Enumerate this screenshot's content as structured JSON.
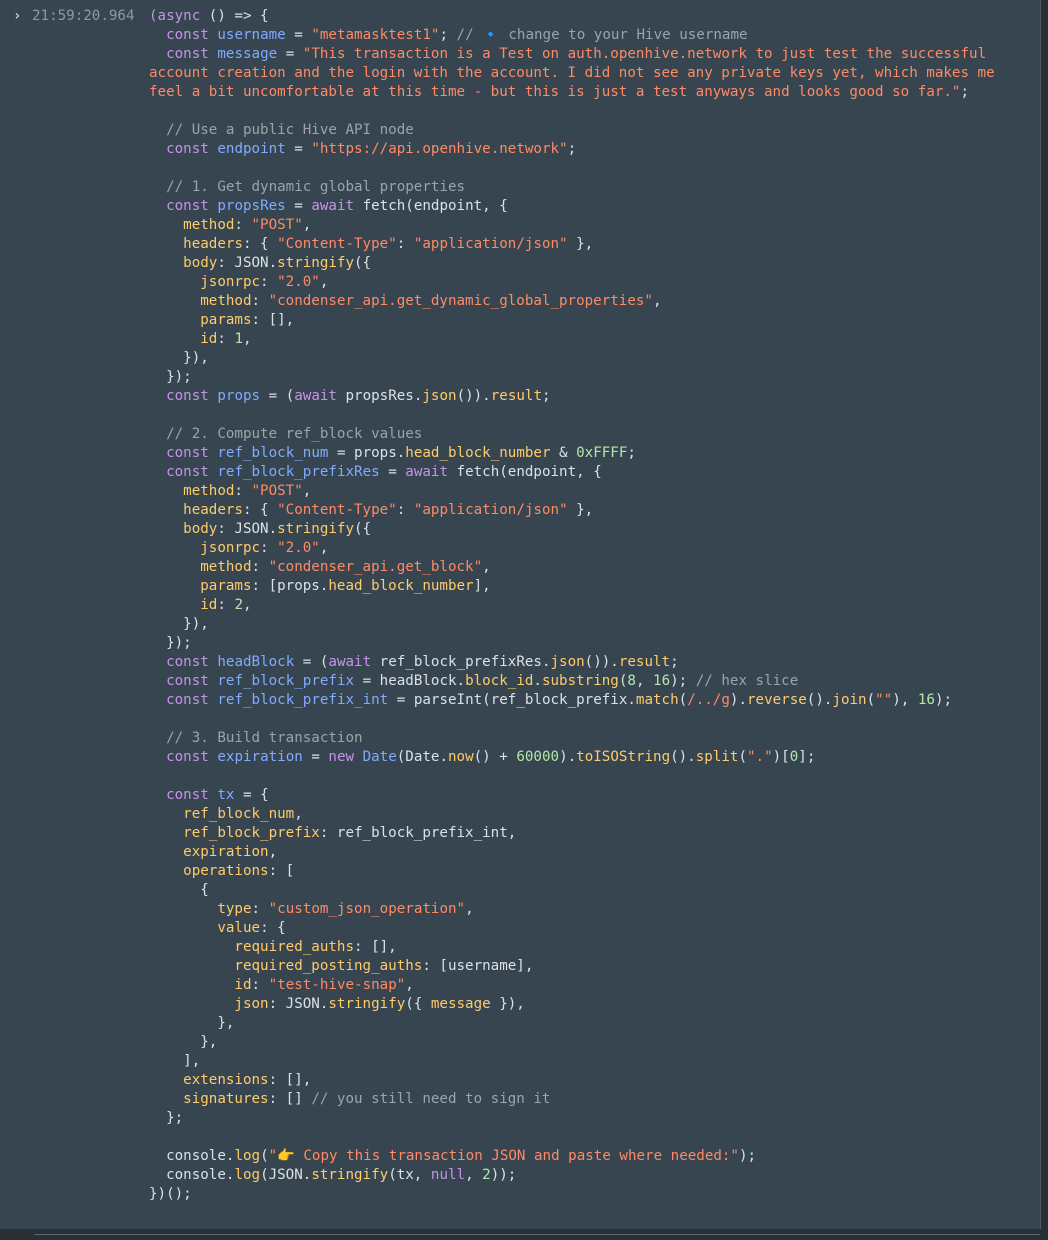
{
  "console": {
    "prompt_symbol": "›",
    "timestamp": "21:59:20.964",
    "accent_string": "#ff8a65",
    "accent_keyword": "#c792ea",
    "accent_variable": "#82aaff",
    "accent_property": "#ffcb6b",
    "accent_number": "#b5e8a8",
    "accent_comment": "#9aa4ab",
    "code_lines": [
      [
        {
          "t": "kw",
          "s": "(async"
        },
        {
          "t": "pl",
          "s": " () => {"
        }
      ],
      [
        {
          "t": "pl",
          "s": "  "
        },
        {
          "t": "kw",
          "s": "const"
        },
        {
          "t": "pl",
          "s": " "
        },
        {
          "t": "vr",
          "s": "username"
        },
        {
          "t": "pl",
          "s": " = "
        },
        {
          "t": "st",
          "s": "\"metamasktest1\""
        },
        {
          "t": "pl",
          "s": "; "
        },
        {
          "t": "cm",
          "s": "// "
        },
        {
          "t": "ic",
          "s": "🔹"
        },
        {
          "t": "cm",
          "s": " change to your Hive username"
        }
      ],
      [
        {
          "t": "pl",
          "s": "  "
        },
        {
          "t": "kw",
          "s": "const"
        },
        {
          "t": "pl",
          "s": " "
        },
        {
          "t": "vr",
          "s": "message"
        },
        {
          "t": "pl",
          "s": " = "
        },
        {
          "t": "st",
          "s": "\"This transaction is a Test on auth.openhive.network to just test the successful account creation and the login with the account. I did not see any private keys yet, which makes me feel a bit uncomfortable at this time - but this is just a test anyways and looks good so far.\""
        },
        {
          "t": "pl",
          "s": ";"
        }
      ],
      [],
      [
        {
          "t": "pl",
          "s": "  "
        },
        {
          "t": "cm",
          "s": "// Use a public Hive API node"
        }
      ],
      [
        {
          "t": "pl",
          "s": "  "
        },
        {
          "t": "kw",
          "s": "const"
        },
        {
          "t": "pl",
          "s": " "
        },
        {
          "t": "vr",
          "s": "endpoint"
        },
        {
          "t": "pl",
          "s": " = "
        },
        {
          "t": "st",
          "s": "\"https://api.openhive.network\""
        },
        {
          "t": "pl",
          "s": ";"
        }
      ],
      [],
      [
        {
          "t": "pl",
          "s": "  "
        },
        {
          "t": "cm",
          "s": "// 1. Get dynamic global properties"
        }
      ],
      [
        {
          "t": "pl",
          "s": "  "
        },
        {
          "t": "kw",
          "s": "const"
        },
        {
          "t": "pl",
          "s": " "
        },
        {
          "t": "vr",
          "s": "propsRes"
        },
        {
          "t": "pl",
          "s": " = "
        },
        {
          "t": "kw",
          "s": "await"
        },
        {
          "t": "pl",
          "s": " fetch(endpoint, {"
        }
      ],
      [
        {
          "t": "pl",
          "s": "    "
        },
        {
          "t": "pr",
          "s": "method"
        },
        {
          "t": "pl",
          "s": ": "
        },
        {
          "t": "st",
          "s": "\"POST\""
        },
        {
          "t": "pl",
          "s": ","
        }
      ],
      [
        {
          "t": "pl",
          "s": "    "
        },
        {
          "t": "pr",
          "s": "headers"
        },
        {
          "t": "pl",
          "s": ": { "
        },
        {
          "t": "st",
          "s": "\"Content-Type\""
        },
        {
          "t": "pl",
          "s": ": "
        },
        {
          "t": "st",
          "s": "\"application/json\""
        },
        {
          "t": "pl",
          "s": " },"
        }
      ],
      [
        {
          "t": "pl",
          "s": "    "
        },
        {
          "t": "pr",
          "s": "body"
        },
        {
          "t": "pl",
          "s": ": JSON."
        },
        {
          "t": "pr",
          "s": "stringify"
        },
        {
          "t": "pl",
          "s": "({"
        }
      ],
      [
        {
          "t": "pl",
          "s": "      "
        },
        {
          "t": "pr",
          "s": "jsonrpc"
        },
        {
          "t": "pl",
          "s": ": "
        },
        {
          "t": "st",
          "s": "\"2.0\""
        },
        {
          "t": "pl",
          "s": ","
        }
      ],
      [
        {
          "t": "pl",
          "s": "      "
        },
        {
          "t": "pr",
          "s": "method"
        },
        {
          "t": "pl",
          "s": ": "
        },
        {
          "t": "st",
          "s": "\"condenser_api.get_dynamic_global_properties\""
        },
        {
          "t": "pl",
          "s": ","
        }
      ],
      [
        {
          "t": "pl",
          "s": "      "
        },
        {
          "t": "pr",
          "s": "params"
        },
        {
          "t": "pl",
          "s": ": [],"
        }
      ],
      [
        {
          "t": "pl",
          "s": "      "
        },
        {
          "t": "pr",
          "s": "id"
        },
        {
          "t": "pl",
          "s": ": "
        },
        {
          "t": "nu",
          "s": "1"
        },
        {
          "t": "pl",
          "s": ","
        }
      ],
      [
        {
          "t": "pl",
          "s": "    }),"
        }
      ],
      [
        {
          "t": "pl",
          "s": "  });"
        }
      ],
      [
        {
          "t": "pl",
          "s": "  "
        },
        {
          "t": "kw",
          "s": "const"
        },
        {
          "t": "pl",
          "s": " "
        },
        {
          "t": "vr",
          "s": "props"
        },
        {
          "t": "pl",
          "s": " = ("
        },
        {
          "t": "kw",
          "s": "await"
        },
        {
          "t": "pl",
          "s": " propsRes."
        },
        {
          "t": "pr",
          "s": "json"
        },
        {
          "t": "pl",
          "s": "())."
        },
        {
          "t": "pr",
          "s": "result"
        },
        {
          "t": "pl",
          "s": ";"
        }
      ],
      [],
      [
        {
          "t": "pl",
          "s": "  "
        },
        {
          "t": "cm",
          "s": "// 2. Compute ref_block values"
        }
      ],
      [
        {
          "t": "pl",
          "s": "  "
        },
        {
          "t": "kw",
          "s": "const"
        },
        {
          "t": "pl",
          "s": " "
        },
        {
          "t": "vr",
          "s": "ref_block_num"
        },
        {
          "t": "pl",
          "s": " = props."
        },
        {
          "t": "pr",
          "s": "head_block_number"
        },
        {
          "t": "pl",
          "s": " & "
        },
        {
          "t": "nu",
          "s": "0xFFFF"
        },
        {
          "t": "pl",
          "s": ";"
        }
      ],
      [
        {
          "t": "pl",
          "s": "  "
        },
        {
          "t": "kw",
          "s": "const"
        },
        {
          "t": "pl",
          "s": " "
        },
        {
          "t": "vr",
          "s": "ref_block_prefixRes"
        },
        {
          "t": "pl",
          "s": " = "
        },
        {
          "t": "kw",
          "s": "await"
        },
        {
          "t": "pl",
          "s": " fetch(endpoint, {"
        }
      ],
      [
        {
          "t": "pl",
          "s": "    "
        },
        {
          "t": "pr",
          "s": "method"
        },
        {
          "t": "pl",
          "s": ": "
        },
        {
          "t": "st",
          "s": "\"POST\""
        },
        {
          "t": "pl",
          "s": ","
        }
      ],
      [
        {
          "t": "pl",
          "s": "    "
        },
        {
          "t": "pr",
          "s": "headers"
        },
        {
          "t": "pl",
          "s": ": { "
        },
        {
          "t": "st",
          "s": "\"Content-Type\""
        },
        {
          "t": "pl",
          "s": ": "
        },
        {
          "t": "st",
          "s": "\"application/json\""
        },
        {
          "t": "pl",
          "s": " },"
        }
      ],
      [
        {
          "t": "pl",
          "s": "    "
        },
        {
          "t": "pr",
          "s": "body"
        },
        {
          "t": "pl",
          "s": ": JSON."
        },
        {
          "t": "pr",
          "s": "stringify"
        },
        {
          "t": "pl",
          "s": "({"
        }
      ],
      [
        {
          "t": "pl",
          "s": "      "
        },
        {
          "t": "pr",
          "s": "jsonrpc"
        },
        {
          "t": "pl",
          "s": ": "
        },
        {
          "t": "st",
          "s": "\"2.0\""
        },
        {
          "t": "pl",
          "s": ","
        }
      ],
      [
        {
          "t": "pl",
          "s": "      "
        },
        {
          "t": "pr",
          "s": "method"
        },
        {
          "t": "pl",
          "s": ": "
        },
        {
          "t": "st",
          "s": "\"condenser_api.get_block\""
        },
        {
          "t": "pl",
          "s": ","
        }
      ],
      [
        {
          "t": "pl",
          "s": "      "
        },
        {
          "t": "pr",
          "s": "params"
        },
        {
          "t": "pl",
          "s": ": [props."
        },
        {
          "t": "pr",
          "s": "head_block_number"
        },
        {
          "t": "pl",
          "s": "],"
        }
      ],
      [
        {
          "t": "pl",
          "s": "      "
        },
        {
          "t": "pr",
          "s": "id"
        },
        {
          "t": "pl",
          "s": ": "
        },
        {
          "t": "nu",
          "s": "2"
        },
        {
          "t": "pl",
          "s": ","
        }
      ],
      [
        {
          "t": "pl",
          "s": "    }),"
        }
      ],
      [
        {
          "t": "pl",
          "s": "  });"
        }
      ],
      [
        {
          "t": "pl",
          "s": "  "
        },
        {
          "t": "kw",
          "s": "const"
        },
        {
          "t": "pl",
          "s": " "
        },
        {
          "t": "vr",
          "s": "headBlock"
        },
        {
          "t": "pl",
          "s": " = ("
        },
        {
          "t": "kw",
          "s": "await"
        },
        {
          "t": "pl",
          "s": " ref_block_prefixRes."
        },
        {
          "t": "pr",
          "s": "json"
        },
        {
          "t": "pl",
          "s": "())."
        },
        {
          "t": "pr",
          "s": "result"
        },
        {
          "t": "pl",
          "s": ";"
        }
      ],
      [
        {
          "t": "pl",
          "s": "  "
        },
        {
          "t": "kw",
          "s": "const"
        },
        {
          "t": "pl",
          "s": " "
        },
        {
          "t": "vr",
          "s": "ref_block_prefix"
        },
        {
          "t": "pl",
          "s": " = headBlock."
        },
        {
          "t": "pr",
          "s": "block_id"
        },
        {
          "t": "pl",
          "s": "."
        },
        {
          "t": "pr",
          "s": "substring"
        },
        {
          "t": "pl",
          "s": "("
        },
        {
          "t": "nu",
          "s": "8"
        },
        {
          "t": "pl",
          "s": ", "
        },
        {
          "t": "nu",
          "s": "16"
        },
        {
          "t": "pl",
          "s": "); "
        },
        {
          "t": "cm",
          "s": "// hex slice"
        }
      ],
      [
        {
          "t": "pl",
          "s": "  "
        },
        {
          "t": "kw",
          "s": "const"
        },
        {
          "t": "pl",
          "s": " "
        },
        {
          "t": "vr",
          "s": "ref_block_prefix_int"
        },
        {
          "t": "pl",
          "s": " = parseInt(ref_block_prefix."
        },
        {
          "t": "pr",
          "s": "match"
        },
        {
          "t": "pl",
          "s": "("
        },
        {
          "t": "st",
          "s": "/../g"
        },
        {
          "t": "pl",
          "s": ")."
        },
        {
          "t": "pr",
          "s": "reverse"
        },
        {
          "t": "pl",
          "s": "()."
        },
        {
          "t": "pr",
          "s": "join"
        },
        {
          "t": "pl",
          "s": "("
        },
        {
          "t": "st",
          "s": "\"\""
        },
        {
          "t": "pl",
          "s": "), "
        },
        {
          "t": "nu",
          "s": "16"
        },
        {
          "t": "pl",
          "s": ");"
        }
      ],
      [],
      [
        {
          "t": "pl",
          "s": "  "
        },
        {
          "t": "cm",
          "s": "// 3. Build transaction"
        }
      ],
      [
        {
          "t": "pl",
          "s": "  "
        },
        {
          "t": "kw",
          "s": "const"
        },
        {
          "t": "pl",
          "s": " "
        },
        {
          "t": "vr",
          "s": "expiration"
        },
        {
          "t": "pl",
          "s": " = "
        },
        {
          "t": "kw",
          "s": "new"
        },
        {
          "t": "pl",
          "s": " "
        },
        {
          "t": "vr",
          "s": "Date"
        },
        {
          "t": "pl",
          "s": "(Date."
        },
        {
          "t": "pr",
          "s": "now"
        },
        {
          "t": "pl",
          "s": "() + "
        },
        {
          "t": "nu",
          "s": "60000"
        },
        {
          "t": "pl",
          "s": ")."
        },
        {
          "t": "pr",
          "s": "toISOString"
        },
        {
          "t": "pl",
          "s": "()."
        },
        {
          "t": "pr",
          "s": "split"
        },
        {
          "t": "pl",
          "s": "("
        },
        {
          "t": "st",
          "s": "\".\""
        },
        {
          "t": "pl",
          "s": ")["
        },
        {
          "t": "nu",
          "s": "0"
        },
        {
          "t": "pl",
          "s": "];"
        }
      ],
      [],
      [
        {
          "t": "pl",
          "s": "  "
        },
        {
          "t": "kw",
          "s": "const"
        },
        {
          "t": "pl",
          "s": " "
        },
        {
          "t": "vr",
          "s": "tx"
        },
        {
          "t": "pl",
          "s": " = {"
        }
      ],
      [
        {
          "t": "pl",
          "s": "    "
        },
        {
          "t": "pr",
          "s": "ref_block_num"
        },
        {
          "t": "pl",
          "s": ","
        }
      ],
      [
        {
          "t": "pl",
          "s": "    "
        },
        {
          "t": "pr",
          "s": "ref_block_prefix"
        },
        {
          "t": "pl",
          "s": ": ref_block_prefix_int,"
        }
      ],
      [
        {
          "t": "pl",
          "s": "    "
        },
        {
          "t": "pr",
          "s": "expiration"
        },
        {
          "t": "pl",
          "s": ","
        }
      ],
      [
        {
          "t": "pl",
          "s": "    "
        },
        {
          "t": "pr",
          "s": "operations"
        },
        {
          "t": "pl",
          "s": ": ["
        }
      ],
      [
        {
          "t": "pl",
          "s": "      {"
        }
      ],
      [
        {
          "t": "pl",
          "s": "        "
        },
        {
          "t": "pr",
          "s": "type"
        },
        {
          "t": "pl",
          "s": ": "
        },
        {
          "t": "st",
          "s": "\"custom_json_operation\""
        },
        {
          "t": "pl",
          "s": ","
        }
      ],
      [
        {
          "t": "pl",
          "s": "        "
        },
        {
          "t": "pr",
          "s": "value"
        },
        {
          "t": "pl",
          "s": ": {"
        }
      ],
      [
        {
          "t": "pl",
          "s": "          "
        },
        {
          "t": "pr",
          "s": "required_auths"
        },
        {
          "t": "pl",
          "s": ": [],"
        }
      ],
      [
        {
          "t": "pl",
          "s": "          "
        },
        {
          "t": "pr",
          "s": "required_posting_auths"
        },
        {
          "t": "pl",
          "s": ": [username],"
        }
      ],
      [
        {
          "t": "pl",
          "s": "          "
        },
        {
          "t": "pr",
          "s": "id"
        },
        {
          "t": "pl",
          "s": ": "
        },
        {
          "t": "st",
          "s": "\"test-hive-snap\""
        },
        {
          "t": "pl",
          "s": ","
        }
      ],
      [
        {
          "t": "pl",
          "s": "          "
        },
        {
          "t": "pr",
          "s": "json"
        },
        {
          "t": "pl",
          "s": ": JSON."
        },
        {
          "t": "pr",
          "s": "stringify"
        },
        {
          "t": "pl",
          "s": "({ "
        },
        {
          "t": "pr",
          "s": "message"
        },
        {
          "t": "pl",
          "s": " }),"
        }
      ],
      [
        {
          "t": "pl",
          "s": "        },"
        }
      ],
      [
        {
          "t": "pl",
          "s": "      },"
        }
      ],
      [
        {
          "t": "pl",
          "s": "    ],"
        }
      ],
      [
        {
          "t": "pl",
          "s": "    "
        },
        {
          "t": "pr",
          "s": "extensions"
        },
        {
          "t": "pl",
          "s": ": [],"
        }
      ],
      [
        {
          "t": "pl",
          "s": "    "
        },
        {
          "t": "pr",
          "s": "signatures"
        },
        {
          "t": "pl",
          "s": ": [] "
        },
        {
          "t": "cm",
          "s": "// you still need to sign it"
        }
      ],
      [
        {
          "t": "pl",
          "s": "  };"
        }
      ],
      [],
      [
        {
          "t": "pl",
          "s": "  console."
        },
        {
          "t": "pr",
          "s": "log"
        },
        {
          "t": "pl",
          "s": "("
        },
        {
          "t": "st",
          "s": "\"👉 Copy this transaction JSON and paste where needed:\""
        },
        {
          "t": "pl",
          "s": ");"
        }
      ],
      [
        {
          "t": "pl",
          "s": "  console."
        },
        {
          "t": "pr",
          "s": "log"
        },
        {
          "t": "pl",
          "s": "(JSON."
        },
        {
          "t": "pr",
          "s": "stringify"
        },
        {
          "t": "pl",
          "s": "(tx, "
        },
        {
          "t": "kw",
          "s": "null"
        },
        {
          "t": "pl",
          "s": ", "
        },
        {
          "t": "nu",
          "s": "2"
        },
        {
          "t": "pl",
          "s": "));"
        }
      ],
      [
        {
          "t": "pl",
          "s": "})();"
        }
      ]
    ]
  }
}
